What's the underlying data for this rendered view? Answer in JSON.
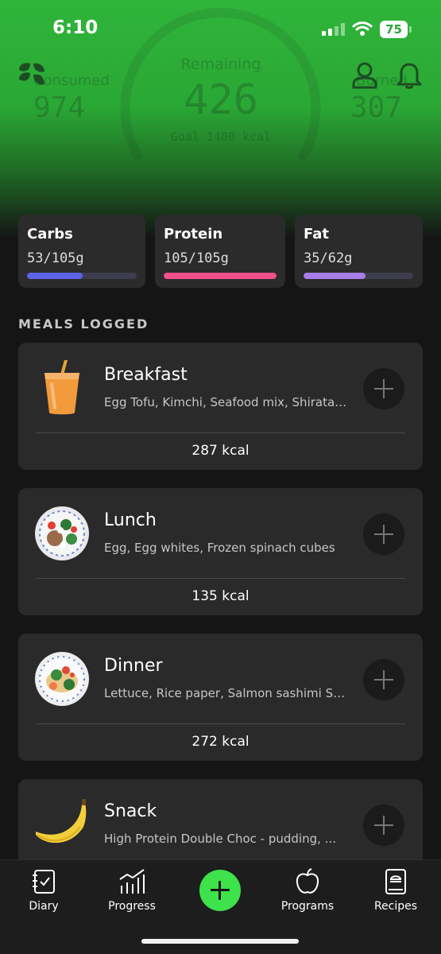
{
  "status_bar": {
    "time": "6:10",
    "battery": "75"
  },
  "summary": {
    "remaining_label": "Remaining",
    "remaining_value": "426",
    "goal_text": "Goal 1400 kcal",
    "consumed_label": "Consumed",
    "consumed_value": "974",
    "burned_label": "Burned",
    "burned_value": "307"
  },
  "macros": [
    {
      "label": "Carbs",
      "value": "53/105g",
      "progress": 0.505,
      "color": "#5b63e6"
    },
    {
      "label": "Protein",
      "value": "105/105g",
      "progress": 1.0,
      "color": "#f0508c"
    },
    {
      "label": "Fat",
      "value": "35/62g",
      "progress": 0.565,
      "color": "#a77ee6"
    }
  ],
  "meals_section_title": "MEALS LOGGED",
  "meals": [
    {
      "name": "Breakfast",
      "items": "Egg Tofu, Kimchi, Seafood mix, Shirataki noodles",
      "kcal": "287 kcal",
      "icon": "iced-drink-icon"
    },
    {
      "name": "Lunch",
      "items": "Egg, Egg whites, Frozen spinach cubes",
      "kcal": "135 kcal",
      "icon": "salad-bowl-icon"
    },
    {
      "name": "Dinner",
      "items": "Lettuce, Rice paper, Salmon sashimi Salad",
      "kcal": "272 kcal",
      "icon": "salad-plate-icon"
    },
    {
      "name": "Snack",
      "items": "High Protein Double Choc - pudding, ...",
      "kcal": "",
      "icon": "banana-icon"
    }
  ],
  "tabs": [
    {
      "label": "Diary",
      "icon": "diary-icon"
    },
    {
      "label": "Progress",
      "icon": "progress-chart-icon"
    },
    {
      "label": "",
      "icon": "add-plus-icon"
    },
    {
      "label": "Programs",
      "icon": "apple-icon"
    },
    {
      "label": "Recipes",
      "icon": "recipe-book-icon"
    }
  ],
  "colors": {
    "accent": "#3ee24a",
    "header_green": "#2aa735",
    "card": "#2a2a2a",
    "background": "#151515"
  }
}
